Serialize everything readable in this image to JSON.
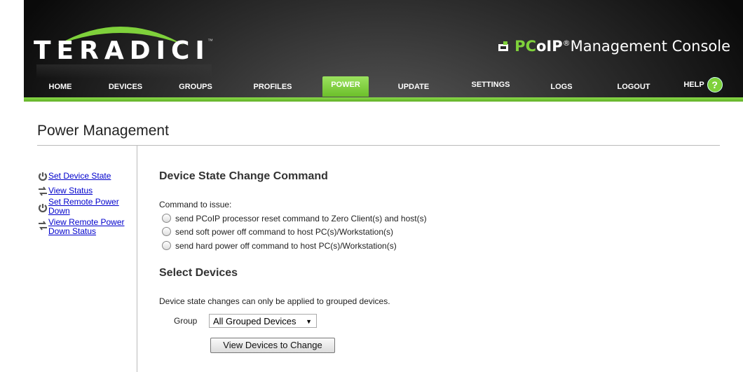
{
  "brand": {
    "logo": "TERADICI",
    "tm": "™",
    "product_pc": "PC",
    "product_oip": "oIP",
    "product_reg": "®",
    "product_rest": "Management Console"
  },
  "nav": {
    "items": [
      {
        "label": "HOME"
      },
      {
        "label": "DEVICES"
      },
      {
        "label": "GROUPS"
      },
      {
        "label": "PROFILES"
      },
      {
        "label": "POWER"
      },
      {
        "label": "UPDATE"
      },
      {
        "label": "SETTINGS"
      },
      {
        "label": "LOGS"
      },
      {
        "label": "LOGOUT"
      },
      {
        "label": "HELP"
      }
    ],
    "active": "POWER",
    "help_icon": "?"
  },
  "page": {
    "title": "Power Management"
  },
  "sidebar": {
    "items": [
      {
        "label": "Set Device State",
        "icon": "power-icon"
      },
      {
        "label": "View Status",
        "icon": "arrows-icon"
      },
      {
        "label": "Set Remote Power Down",
        "icon": "power-icon"
      },
      {
        "label": "View Remote Power Down Status",
        "icon": "arrows-icon"
      }
    ]
  },
  "command": {
    "heading": "Device State Change Command",
    "label": "Command to issue:",
    "options": [
      "send PCoIP processor reset command to Zero Client(s) and host(s)",
      "send soft power off command to host PC(s)/Workstation(s)",
      "send hard power off command to host PC(s)/Workstation(s)"
    ]
  },
  "devices": {
    "heading": "Select Devices",
    "note": "Device state changes can only be applied to grouped devices.",
    "group_label": "Group",
    "group_value": "All Grouped Devices",
    "button": "View Devices to Change"
  },
  "colors": {
    "accent": "#7fd13b",
    "link": "#0000cc"
  }
}
